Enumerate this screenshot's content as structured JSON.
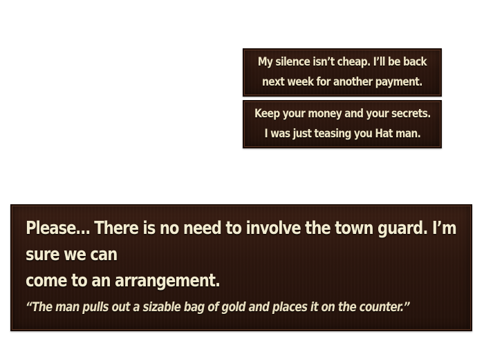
{
  "choices": [
    {
      "line1": "My silence isn’t cheap. I’ll be back",
      "line2": "next week for another payment."
    },
    {
      "line1": "Keep your money and your secrets.",
      "line2": "I was just teasing you Hat man."
    }
  ],
  "dialogue": {
    "speech_line1": "Please… There is no need to involve the town guard. I’m sure we can",
    "speech_line2": "come to an arrangement.",
    "narration": "“The man pulls out a sizable bag of gold and places it on the counter.”"
  },
  "colors": {
    "panel": "#2c160e",
    "panel_border": "#1a0c06",
    "text": "#f1e7c7"
  }
}
